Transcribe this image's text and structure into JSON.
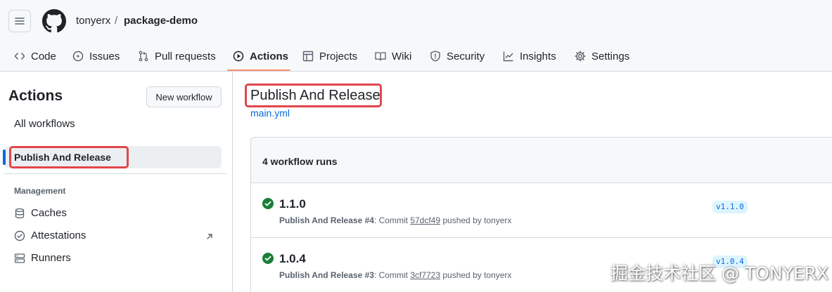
{
  "header": {
    "owner": "tonyerx",
    "separator": "/",
    "repo": "package-demo"
  },
  "tabs": [
    {
      "label": "Code",
      "icon": "code-icon"
    },
    {
      "label": "Issues",
      "icon": "issue-icon"
    },
    {
      "label": "Pull requests",
      "icon": "pull-request-icon"
    },
    {
      "label": "Actions",
      "icon": "play-icon",
      "active": true
    },
    {
      "label": "Projects",
      "icon": "table-icon"
    },
    {
      "label": "Wiki",
      "icon": "book-icon"
    },
    {
      "label": "Security",
      "icon": "shield-icon"
    },
    {
      "label": "Insights",
      "icon": "graph-icon"
    },
    {
      "label": "Settings",
      "icon": "gear-icon"
    }
  ],
  "sidebar": {
    "title": "Actions",
    "new_workflow": "New workflow",
    "all_workflows": "All workflows",
    "selected_workflow": "Publish And Release",
    "section_label": "Management",
    "items": [
      {
        "label": "Caches",
        "icon": "cache-icon"
      },
      {
        "label": "Attestations",
        "icon": "verified-icon"
      },
      {
        "label": "Runners",
        "icon": "server-icon"
      }
    ]
  },
  "main": {
    "title": "Publish And Release",
    "file": "main.yml",
    "runs_count": "4 workflow runs",
    "runs": [
      {
        "title": "1.1.0",
        "workflow": "Publish And Release",
        "run_number": "#4",
        "commit_prefix": ": Commit",
        "sha": "57dcf49",
        "pushed_by": "pushed by tonyerx",
        "tag": "v1.1.0"
      },
      {
        "title": "1.0.4",
        "workflow": "Publish And Release",
        "run_number": "#3",
        "commit_prefix": ": Commit",
        "sha": "3cf7723",
        "pushed_by": "pushed by tonyerx",
        "tag": "v1.0.4"
      }
    ]
  },
  "watermark": "掘金技术社区 @ TONYERX",
  "colors": {
    "highlight": "#e0474c",
    "success": "#1a7f37",
    "link": "#0969da",
    "tab_underline": "#fd8c73"
  }
}
